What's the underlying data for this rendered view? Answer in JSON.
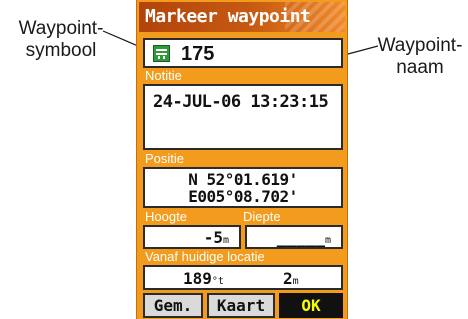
{
  "callouts": {
    "symbol": "Waypoint-\nsymbool",
    "name": "Waypoint-\nnaam"
  },
  "screen": {
    "title": "Markeer waypoint",
    "symbol_icon": "waypoint-flag-icon",
    "name_value": "175",
    "note_label": "Notitie",
    "note_value": "24-JUL-06 13:23:15",
    "position_label": "Positie",
    "position_n": "N 52°01.619'",
    "position_e": "E005°08.702'",
    "altitude_label": "Hoogte",
    "depth_label": "Diepte",
    "altitude_value": "-5",
    "altitude_unit": "m",
    "depth_value": "_____",
    "depth_unit": "m",
    "from_label": "Vanaf huidige locatie",
    "bearing_value": "189",
    "bearing_unit": "°t",
    "distance_value": "2",
    "distance_unit": "m"
  },
  "buttons": {
    "gem": "Gem.",
    "kaart": "Kaart",
    "ok": "OK"
  },
  "colors": {
    "screen_bg": "#f39b1c",
    "title_bg": "#b2440a",
    "ok_text": "#f6ff00"
  }
}
